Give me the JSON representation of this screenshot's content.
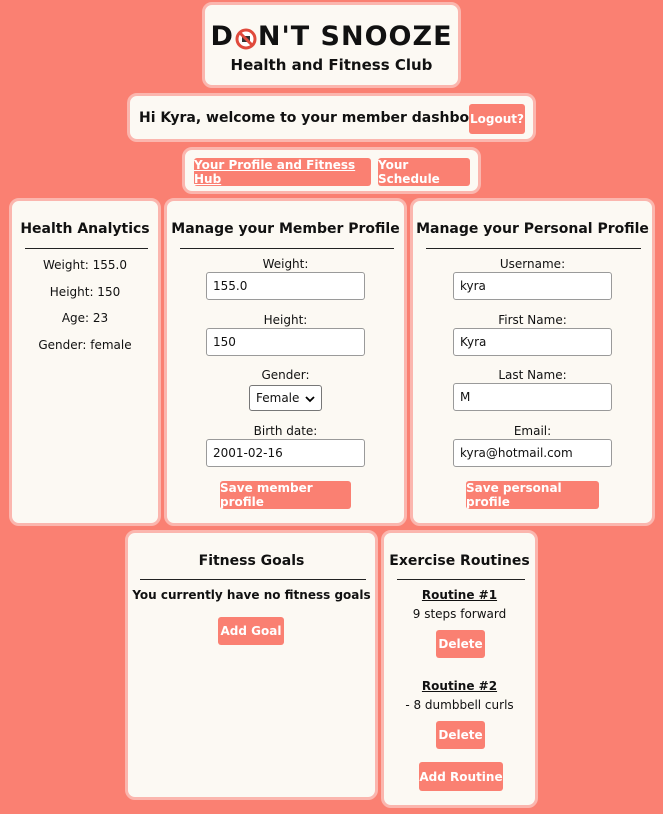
{
  "header": {
    "logo_prefix": "D",
    "logo_suffix": "N'T SNOOZE",
    "subtitle": "Health and Fitness Club"
  },
  "welcome": {
    "message": "Hi Kyra, welcome to your member dashboard!",
    "logout_label": "Logout?"
  },
  "nav": {
    "profile_hub": "Your Profile and Fitness Hub",
    "schedule": "Your Schedule"
  },
  "analytics": {
    "title": "Health Analytics",
    "weight": "Weight: 155.0",
    "height": "Height: 150",
    "age": "Age: 23",
    "gender": "Gender: female"
  },
  "member_profile": {
    "title": "Manage your Member Profile",
    "weight_label": "Weight:",
    "weight_value": "155.0",
    "height_label": "Height:",
    "height_value": "150",
    "gender_label": "Gender:",
    "gender_value": "Female",
    "birth_label": "Birth date:",
    "birth_value": "2001-02-16",
    "save_label": "Save member profile"
  },
  "personal_profile": {
    "title": "Manage your Personal Profile",
    "username_label": "Username:",
    "username_value": "kyra",
    "first_label": "First Name:",
    "first_value": "Kyra",
    "last_label": "Last Name:",
    "last_value": "M",
    "email_label": "Email:",
    "email_value": "kyra@hotmail.com",
    "save_label": "Save personal profile"
  },
  "goals": {
    "title": "Fitness Goals",
    "empty_message": "You currently have no fitness goals",
    "add_label": "Add Goal"
  },
  "routines": {
    "title": "Exercise Routines",
    "items": [
      {
        "name": "Routine #1",
        "description": "9 steps forward",
        "delete_label": "Delete"
      },
      {
        "name": "Routine #2",
        "description": "- 8 dumbbell curls",
        "delete_label": "Delete"
      }
    ],
    "add_label": "Add Routine"
  },
  "colors": {
    "background": "#fa8072",
    "card": "#fcf9f3",
    "card_border": "#fbb6ae",
    "button": "#fa8072"
  },
  "icons": {
    "logo": "no-sleep-icon"
  }
}
